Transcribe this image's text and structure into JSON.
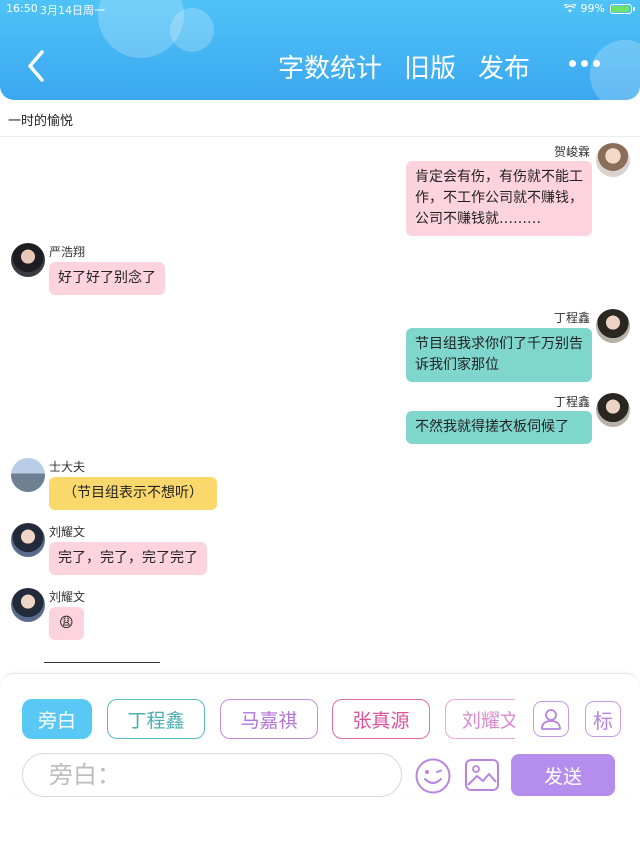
{
  "status_bar": {
    "time": "16:50",
    "date": "3月14日周一",
    "battery": "99%"
  },
  "header": {
    "back_icon": "chevron-left-icon",
    "nav": [
      "字数统计",
      "旧版",
      "发布"
    ],
    "more_icon": "more-dots-icon"
  },
  "document": {
    "title": "一时的愉悦"
  },
  "messages": [
    {
      "side": "right",
      "name": "贺峻霖",
      "text": "肯定会有伤，有伤就不能工作，不工作公司就不赚钱，公司不赚钱就………",
      "color": "#fdd3de"
    },
    {
      "side": "left",
      "name": "严浩翔",
      "text": "好了好了别念了",
      "color": "#fdd3de"
    },
    {
      "side": "right",
      "name": "丁程鑫",
      "text": "节目组我求你们了千万别告诉我们家那位",
      "color": "#7fd6cc"
    },
    {
      "side": "right",
      "name": "丁程鑫",
      "text": "不然我就得搓衣板伺候了",
      "color": "#7fd6cc"
    },
    {
      "side": "left",
      "name": "士大夫",
      "text": "（节目组表示不想听）",
      "color": "#fbd86b"
    },
    {
      "side": "left",
      "name": "刘耀文",
      "text": "完了，完了，完了完了",
      "color": "#fdd3de"
    },
    {
      "side": "left",
      "name": "刘耀文",
      "text": "😩",
      "color": "#fdd3de"
    }
  ],
  "composer": {
    "roles": [
      "旁白",
      "丁程鑫",
      "马嘉祺",
      "张真源",
      "刘耀文"
    ],
    "tag_label": "标",
    "input_placeholder": "旁白：",
    "send_label": "发送"
  },
  "colors": {
    "header": "#3ba7f0",
    "narrator_chip": "#5ac8f5",
    "send": "#b58ded"
  }
}
